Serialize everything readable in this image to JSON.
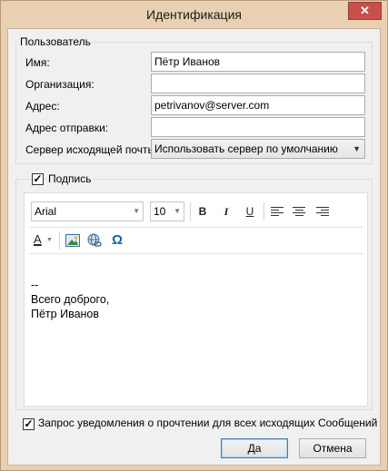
{
  "window": {
    "title": "Идентификация",
    "close_glyph": "✕",
    "accent": "#e9d0b2",
    "close_color": "#c7504a"
  },
  "user_group": {
    "legend": "Пользователь",
    "name_label": "Имя:",
    "name_value": "Пётр Иванов",
    "org_label": "Организация:",
    "org_value": "",
    "address_label": "Адрес:",
    "address_value": "petrivanov@server.com",
    "reply_label": "Адрес отправки:",
    "reply_value": "",
    "smtp_label": "Сервер исходящей почты:",
    "smtp_value": "Использовать сервер по умолчанию"
  },
  "signature": {
    "enabled": true,
    "label": "Подпись",
    "font_name": "Arial",
    "font_size": "10",
    "bold": "B",
    "italic": "I",
    "underline": "U",
    "text_color_glyph": "A",
    "special_char": "Ω",
    "text_line1": "--",
    "text_line2": "Всего доброго,",
    "text_line3": "Пётр Иванов"
  },
  "read_receipt": {
    "enabled": true,
    "label": "Запрос уведомления о прочтении для всех исходящих Сообщений"
  },
  "buttons": {
    "ok": "Да",
    "cancel": "Отмена"
  }
}
